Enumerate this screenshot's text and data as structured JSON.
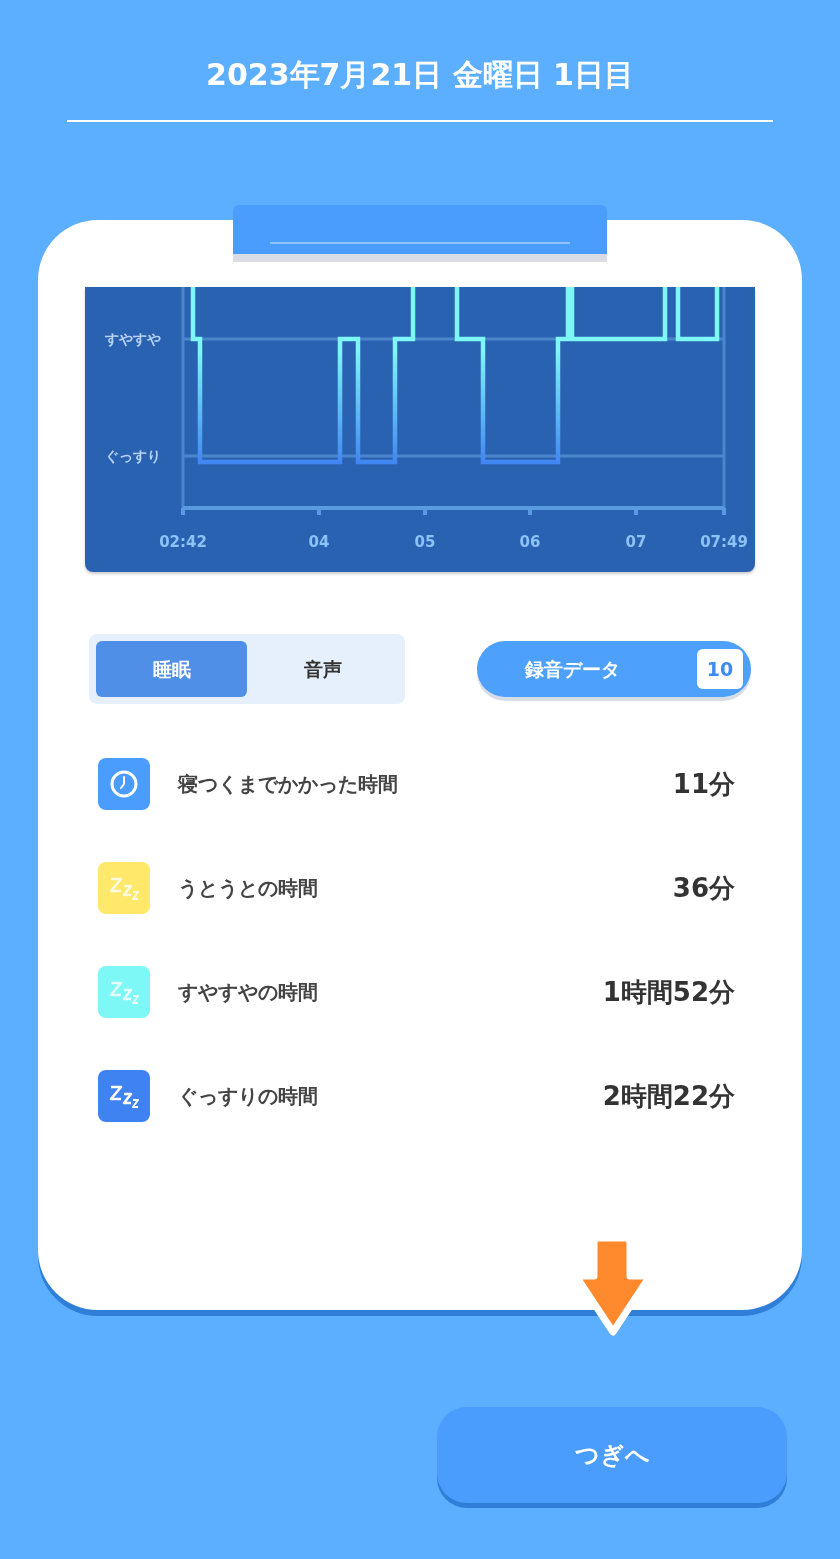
{
  "header": {
    "title": "2023年7月21日 金曜日 1日目"
  },
  "chart": {
    "y_labels": [
      "すやすや",
      "ぐっすり"
    ],
    "x_labels": [
      "02:42",
      "04",
      "05",
      "06",
      "07",
      "07:49"
    ]
  },
  "tabs": [
    {
      "label": "睡眠",
      "selected": true
    },
    {
      "label": "音声",
      "selected": false
    }
  ],
  "recordings_button": {
    "label": "録音データ",
    "count": "10"
  },
  "stats": [
    {
      "kind": "clock",
      "color": "#4a9dfd",
      "label": "寝つくまでかかった時間",
      "value": "11分"
    },
    {
      "kind": "zzz",
      "color": "#ffe86a",
      "label": "うとうとの時間",
      "value": "36分"
    },
    {
      "kind": "zzz",
      "color": "#7ef7f7",
      "label": "すやすやの時間",
      "value": "1時間52分"
    },
    {
      "kind": "zzz",
      "color": "#3f82f2",
      "label": "ぐっすりの時間",
      "value": "2時間22分"
    }
  ],
  "next_button": {
    "label": "つぎへ"
  }
}
